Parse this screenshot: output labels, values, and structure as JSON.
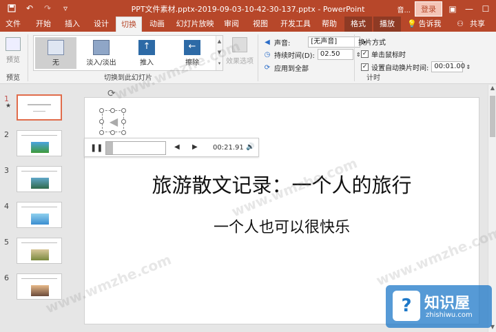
{
  "titlebar": {
    "doc_title": "PPT文件素材.pptx-2019-09-03-10-42-30-137.pptx  -  PowerPoint",
    "right_small": "音...",
    "login": "登录",
    "qat_icons": [
      "save-icon",
      "undo-icon",
      "redo-icon",
      "customize-icon"
    ]
  },
  "tabs": {
    "file": "文件",
    "home": "开始",
    "insert": "插入",
    "design": "设计",
    "transitions": "切换",
    "animations": "动画",
    "slideshow": "幻灯片放映",
    "review": "审阅",
    "view": "视图",
    "developer": "开发工具",
    "help": "帮助",
    "format": "格式",
    "playback": "播放",
    "tellme": "告诉我",
    "share": "共享"
  },
  "ribbon": {
    "preview_label": "预览",
    "preview_group": "预览",
    "transition_group": "切换到此幻灯片",
    "transitions": [
      {
        "label": "无",
        "selected": true
      },
      {
        "label": "淡入/淡出",
        "selected": false
      },
      {
        "label": "推入",
        "selected": false
      },
      {
        "label": "擦除",
        "selected": false
      }
    ],
    "effect_options": "效果选项",
    "timing_group": "计时",
    "sound_label": "声音:",
    "sound_value": "[无声音]",
    "duration_label": "持续时间(D):",
    "duration_value": "02.50",
    "apply_all": "应用到全部",
    "advance_title": "换片方式",
    "on_click_label": "单击鼠标时",
    "on_click_checked": true,
    "after_label": "设置自动换片时间:",
    "after_checked": true,
    "after_value": "00:01.00"
  },
  "thumbnails": [
    {
      "num": "1",
      "star": "★",
      "selected": true
    },
    {
      "num": "2",
      "star": "",
      "selected": false
    },
    {
      "num": "3",
      "star": "",
      "selected": false
    },
    {
      "num": "4",
      "star": "",
      "selected": false
    },
    {
      "num": "5",
      "star": "",
      "selected": false
    },
    {
      "num": "6",
      "star": "",
      "selected": false
    }
  ],
  "slide": {
    "title": "旅游散文记录：一个人的旅行",
    "subtitle": "一个人也可以很快乐"
  },
  "player": {
    "time": "00:21.91",
    "progress_fraction": 0.12
  },
  "watermark": {
    "text": "www.wmzhe.com",
    "logo_text": "知识屋",
    "logo_site": "zhishiwu.com",
    "logo_mark": "?"
  },
  "colors": {
    "accent": "#b7472a",
    "context_tab": "#8e3a24",
    "selected_thumb": "#e06b4a"
  }
}
